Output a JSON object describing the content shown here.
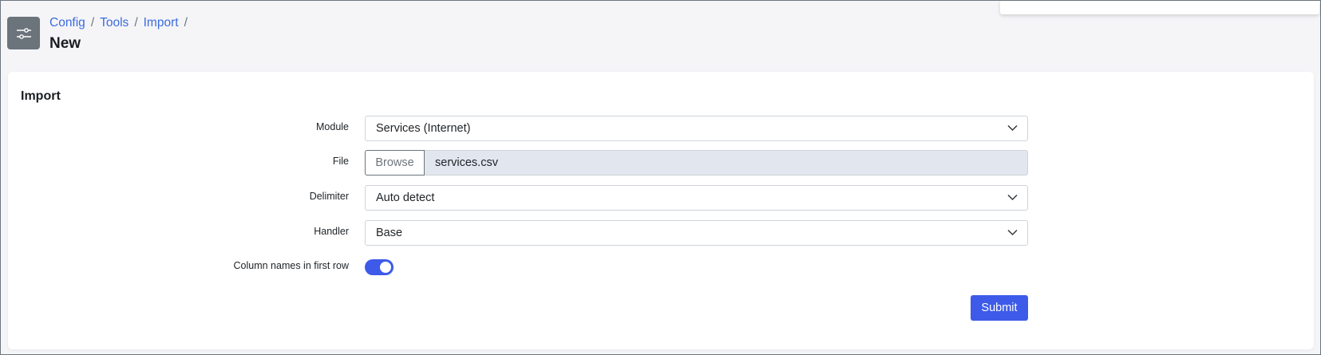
{
  "breadcrumb": [
    {
      "label": "Config"
    },
    {
      "label": "Tools"
    },
    {
      "label": "Import"
    }
  ],
  "breadcrumb_separator": "/",
  "page_title": "New",
  "card": {
    "title": "Import",
    "fields": {
      "module": {
        "label": "Module",
        "value": "Services (Internet)"
      },
      "file": {
        "label": "File",
        "browse_label": "Browse",
        "file_name": "services.csv"
      },
      "delimiter": {
        "label": "Delimiter",
        "value": "Auto detect"
      },
      "handler": {
        "label": "Handler",
        "value": "Base"
      },
      "column_names": {
        "label": "Column names in first row",
        "enabled": true
      }
    },
    "submit_label": "Submit"
  },
  "icons": {
    "app": "sliders-icon",
    "select_caret": "chevron-down-icon"
  },
  "colors": {
    "accent": "#3d5be8",
    "link": "#3c6bdc",
    "app_icon_bg": "#6b737b",
    "file_input_bg": "#e2e6ee"
  }
}
